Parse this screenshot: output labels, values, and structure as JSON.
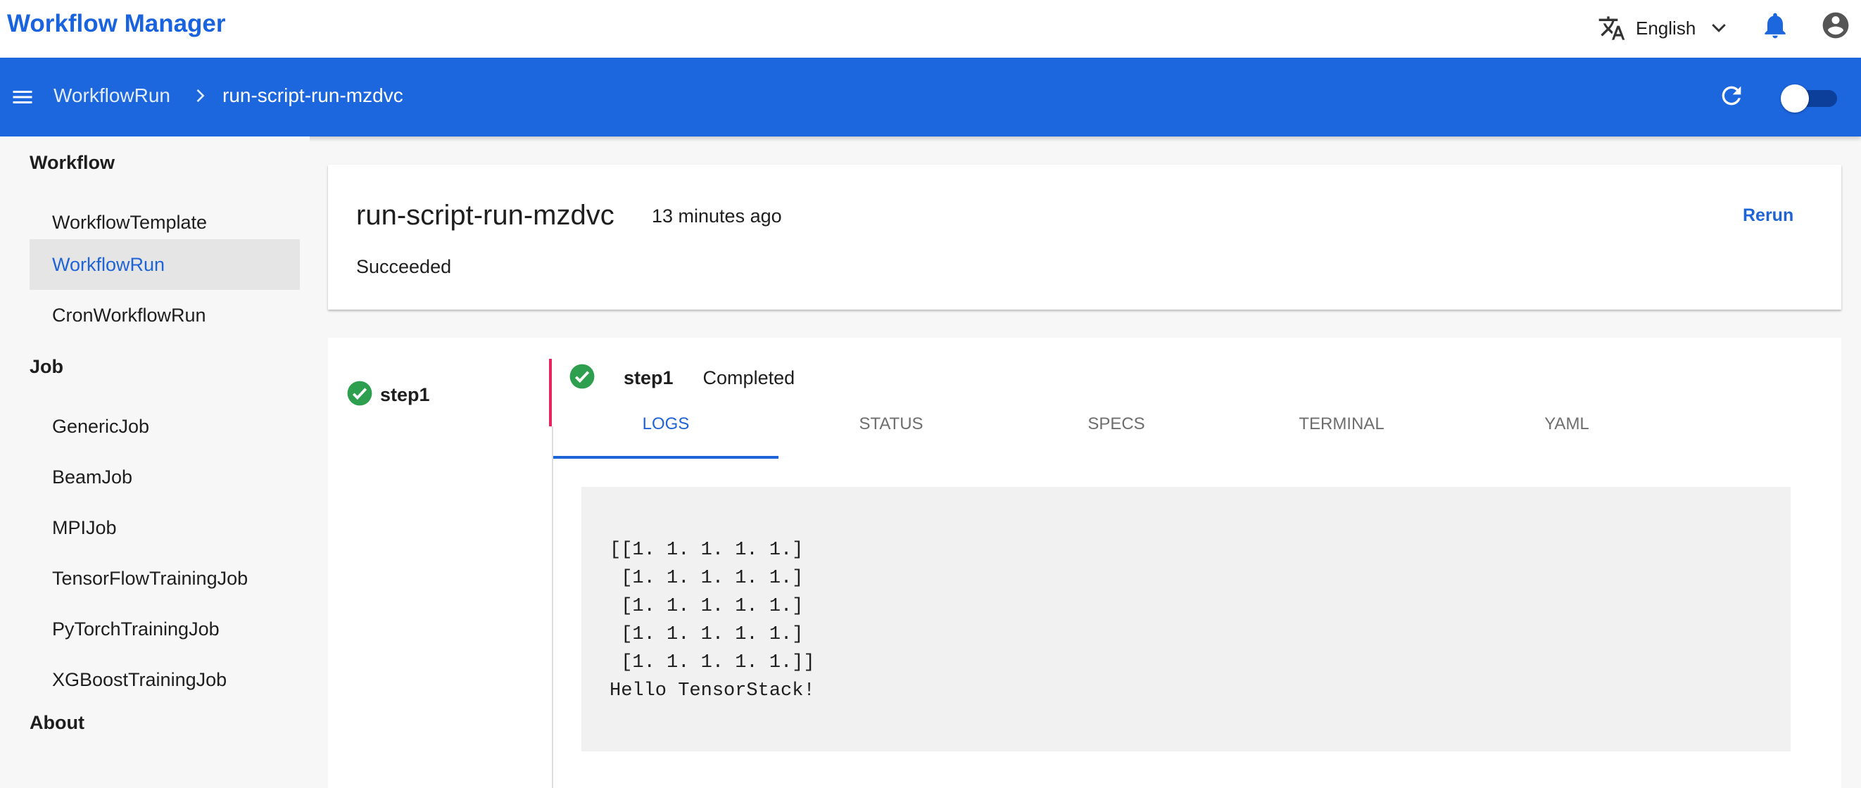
{
  "app": {
    "title": "Workflow Manager"
  },
  "header": {
    "language_icon": "translate-icon",
    "language": "English",
    "bell_icon": "bell-icon",
    "account_icon": "account-circle-icon"
  },
  "toolbar": {
    "menu_icon": "menu-icon",
    "breadcrumb_parent": "WorkflowRun",
    "breadcrumb_current": "run-script-run-mzdvc",
    "refresh_icon": "refresh-icon"
  },
  "colors": {
    "brand": "#1a63de",
    "bar": "#1c66de",
    "success": "#2e9e4f",
    "active_step": "#e8245e"
  },
  "sidebar": {
    "groups": [
      {
        "label": "Workflow",
        "items": [
          "WorkflowTemplate",
          "WorkflowRun",
          "CronWorkflowRun"
        ]
      },
      {
        "label": "Job",
        "items": [
          "GenericJob",
          "BeamJob",
          "MPIJob",
          "TensorFlowTrainingJob",
          "PyTorchTrainingJob",
          "XGBoostTrainingJob"
        ]
      },
      {
        "label": "About",
        "items": []
      }
    ],
    "active": "WorkflowRun"
  },
  "run": {
    "name": "run-script-run-mzdvc",
    "time": "13 minutes ago",
    "status": "Succeeded",
    "rerun_label": "Rerun"
  },
  "steps": [
    {
      "name": "step1",
      "status": "Completed"
    }
  ],
  "selected_step": {
    "name": "step1",
    "status": "Completed"
  },
  "tabs": [
    "LOGS",
    "STATUS",
    "SPECS",
    "TERMINAL",
    "YAML"
  ],
  "active_tab": "LOGS",
  "logs": "[[1. 1. 1. 1. 1.]\n [1. 1. 1. 1. 1.]\n [1. 1. 1. 1. 1.]\n [1. 1. 1. 1. 1.]\n [1. 1. 1. 1. 1.]]\nHello TensorStack!"
}
